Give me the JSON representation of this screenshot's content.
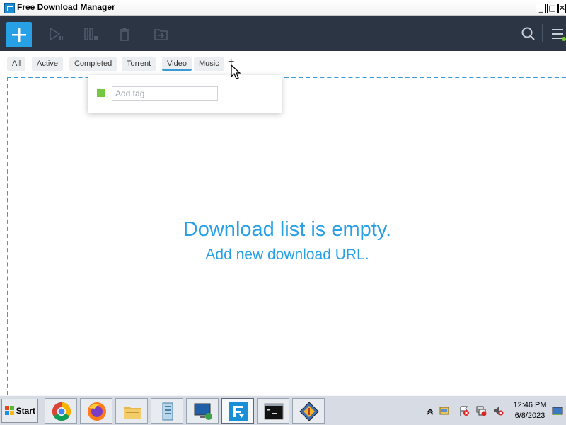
{
  "window": {
    "title": "Free Download Manager",
    "minimize_glyph": "_",
    "maximize_glyph": "□",
    "close_glyph": "✕"
  },
  "toolbar": {
    "add_icon": "plus-icon",
    "icons": [
      "play-icon",
      "pause-icon",
      "trash-icon",
      "move-to-folder-icon",
      "search-icon",
      "menu-icon"
    ],
    "accent": "#27a0e6",
    "background": "#2b3544"
  },
  "tabs": [
    {
      "label": "All"
    },
    {
      "label": "Active"
    },
    {
      "label": "Completed"
    },
    {
      "label": "Torrent"
    },
    {
      "label": "Video"
    },
    {
      "label": "Music"
    }
  ],
  "tab_add_label": "+",
  "tag_popup": {
    "placeholder": "Add tag",
    "color": "#74c73e"
  },
  "empty_state": {
    "title": "Download list is empty.",
    "subtitle": "Add new download URL."
  },
  "taskbar": {
    "start_label": "Start",
    "apps": [
      "chrome-icon",
      "firefox-icon",
      "file-explorer-icon",
      "document-icon",
      "remote-desktop-icon",
      "free-download-manager-icon",
      "command-prompt-icon",
      "network-icon"
    ],
    "clock_time": "12:46 PM",
    "clock_date": "6/8/2023"
  }
}
